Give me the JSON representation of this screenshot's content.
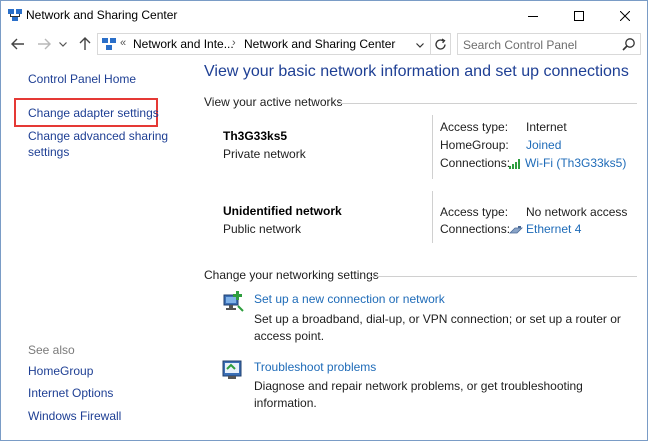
{
  "window": {
    "title": "Network and Sharing Center",
    "min_glyph": "—",
    "max_glyph": "☐",
    "close_glyph": "✕"
  },
  "nav": {
    "back_icon": "arrow-left-icon",
    "forward_icon": "arrow-right-icon",
    "recent_icon": "chevron-down-icon",
    "up_icon": "arrow-up-icon",
    "address": {
      "overflow": "«",
      "crumb1": "Network and Inte...",
      "sep": "›",
      "crumb2": "Network and Sharing Center"
    },
    "search_placeholder": "Search Control Panel"
  },
  "sidebar": {
    "home": "Control Panel Home",
    "adapter": "Change adapter settings",
    "advanced": "Change advanced sharing settings",
    "see_also": "See also",
    "see_also_items": [
      "HomeGroup",
      "Internet Options",
      "Windows Firewall"
    ]
  },
  "main": {
    "title": "View your basic network information and set up connections",
    "active_header": "View your active networks",
    "networks": [
      {
        "name": "Th3G33ks5",
        "type": "Private network",
        "access_label": "Access type:",
        "access_value": "Internet",
        "homegroup_label": "HomeGroup:",
        "homegroup_value": "Joined",
        "conn_label": "Connections:",
        "conn_value": "Wi-Fi (Th3G33ks5)"
      },
      {
        "name": "Unidentified network",
        "type": "Public network",
        "access_label": "Access type:",
        "access_value": "No network access",
        "conn_label": "Connections:",
        "conn_value": "Ethernet 4"
      }
    ],
    "change_header": "Change your networking settings",
    "tasks": [
      {
        "link": "Set up a new connection or network",
        "desc": "Set up a broadband, dial-up, or VPN connection; or set up a router or access point."
      },
      {
        "link": "Troubleshoot problems",
        "desc": "Diagnose and repair network problems, or get troubleshooting information."
      }
    ]
  },
  "colors": {
    "link": "#1e3f94",
    "link_blue": "#1e6bb8",
    "highlight": "#e53935"
  }
}
